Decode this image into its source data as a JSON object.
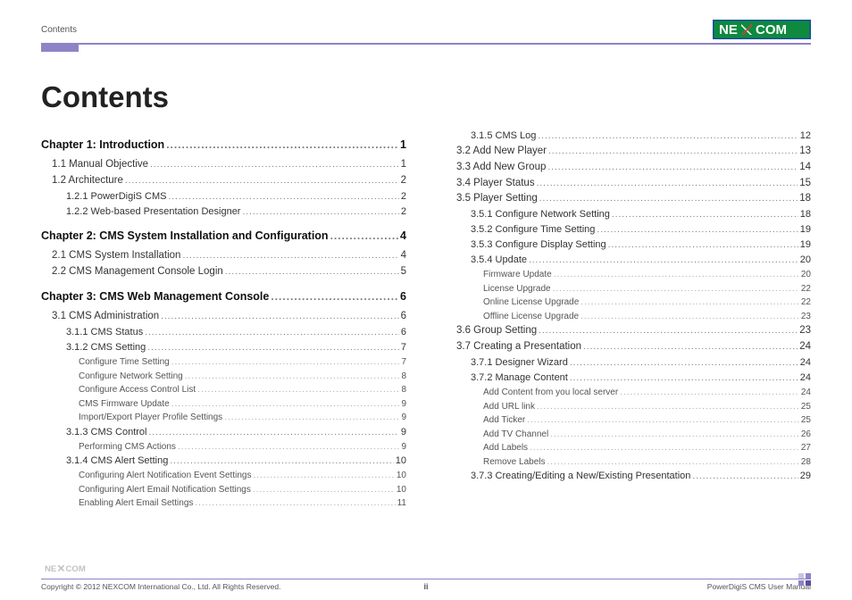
{
  "header": {
    "section_label": "Contents"
  },
  "title": "Contents",
  "logo": {
    "left": "NE",
    "right": "COM"
  },
  "toc": {
    "col1": [
      {
        "cls": "chapter",
        "label": "Chapter 1: Introduction",
        "page": "1"
      },
      {
        "cls": "lvl1",
        "label": "1.1 Manual Objective",
        "page": "1"
      },
      {
        "cls": "lvl1",
        "label": "1.2 Architecture",
        "page": "2"
      },
      {
        "cls": "lvl2",
        "label": "1.2.1 PowerDigiS CMS",
        "page": "2"
      },
      {
        "cls": "lvl2",
        "label": "1.2.2 Web-based Presentation Designer",
        "page": "2"
      },
      {
        "cls": "chapter",
        "label": "Chapter 2: CMS System Installation and Configuration",
        "page": "4"
      },
      {
        "cls": "lvl1",
        "label": "2.1 CMS System Installation",
        "page": "4"
      },
      {
        "cls": "lvl1",
        "label": "2.2 CMS Management Console Login",
        "page": "5"
      },
      {
        "cls": "chapter",
        "label": "Chapter 3: CMS Web Management Console",
        "page": "6"
      },
      {
        "cls": "lvl1",
        "label": "3.1 CMS Administration",
        "page": "6"
      },
      {
        "cls": "lvl2",
        "label": "3.1.1 CMS Status",
        "page": "6"
      },
      {
        "cls": "lvl2",
        "label": "3.1.2 CMS Setting",
        "page": "7"
      },
      {
        "cls": "lvl3",
        "label": "Configure Time Setting",
        "page": "7"
      },
      {
        "cls": "lvl3",
        "label": "Configure Network Setting",
        "page": "8"
      },
      {
        "cls": "lvl3",
        "label": "Configure Access Control List",
        "page": "8"
      },
      {
        "cls": "lvl3",
        "label": "CMS Firmware Update",
        "page": "9"
      },
      {
        "cls": "lvl3",
        "label": "Import/Export Player Profile Settings",
        "page": "9"
      },
      {
        "cls": "lvl2",
        "label": "3.1.3 CMS Control",
        "page": "9"
      },
      {
        "cls": "lvl3",
        "label": "Performing CMS Actions",
        "page": "9"
      },
      {
        "cls": "lvl2",
        "label": "3.1.4 CMS Alert Setting",
        "page": "10"
      },
      {
        "cls": "lvl3",
        "label": "Configuring Alert Notification Event Settings",
        "page": "10"
      },
      {
        "cls": "lvl3",
        "label": "Configuring Alert Email Notification Settings",
        "page": "10"
      },
      {
        "cls": "lvl3",
        "label": "Enabling Alert Email Settings",
        "page": "11"
      }
    ],
    "col2": [
      {
        "cls": "lvl2",
        "label": "3.1.5 CMS Log",
        "page": "12"
      },
      {
        "cls": "lvl1",
        "label": "3.2 Add New Player",
        "page": "13"
      },
      {
        "cls": "lvl1",
        "label": "3.3 Add New Group",
        "page": "14"
      },
      {
        "cls": "lvl1",
        "label": "3.4 Player Status",
        "page": "15"
      },
      {
        "cls": "lvl1",
        "label": "3.5 Player Setting",
        "page": "18"
      },
      {
        "cls": "lvl2",
        "label": "3.5.1 Configure Network Setting",
        "page": "18"
      },
      {
        "cls": "lvl2",
        "label": "3.5.2 Configure Time Setting",
        "page": "19"
      },
      {
        "cls": "lvl2",
        "label": "3.5.3 Configure Display Setting",
        "page": "19"
      },
      {
        "cls": "lvl2",
        "label": "3.5.4 Update",
        "page": "20"
      },
      {
        "cls": "lvl3",
        "label": "Firmware Update",
        "page": "20"
      },
      {
        "cls": "lvl3",
        "label": "License Upgrade",
        "page": "22"
      },
      {
        "cls": "lvl3",
        "label": "Online License Upgrade",
        "page": "22"
      },
      {
        "cls": "lvl3",
        "label": "Offline License Upgrade",
        "page": "23"
      },
      {
        "cls": "lvl1",
        "label": "3.6 Group Setting",
        "page": "23"
      },
      {
        "cls": "lvl1",
        "label": "3.7 Creating a Presentation",
        "page": "24"
      },
      {
        "cls": "lvl2",
        "label": "3.7.1 Designer Wizard",
        "page": "24"
      },
      {
        "cls": "lvl2",
        "label": "3.7.2 Manage Content",
        "page": "24"
      },
      {
        "cls": "lvl3",
        "label": "Add Content from you local server",
        "page": "24"
      },
      {
        "cls": "lvl3",
        "label": "Add URL link",
        "page": "25"
      },
      {
        "cls": "lvl3",
        "label": "Add Ticker",
        "page": "25"
      },
      {
        "cls": "lvl3",
        "label": "Add TV Channel",
        "page": "26"
      },
      {
        "cls": "lvl3",
        "label": "Add Labels",
        "page": "27"
      },
      {
        "cls": "lvl3",
        "label": "Remove Labels",
        "page": "28"
      },
      {
        "cls": "lvl2",
        "label": "3.7.3 Creating/Editing a New/Existing Presentation",
        "page": "29"
      }
    ]
  },
  "footer": {
    "copyright": "Copyright © 2012 NEXCOM International Co., Ltd. All Rights Reserved.",
    "page_number": "ii",
    "doc_title": "PowerDigiS CMS User Manual"
  }
}
